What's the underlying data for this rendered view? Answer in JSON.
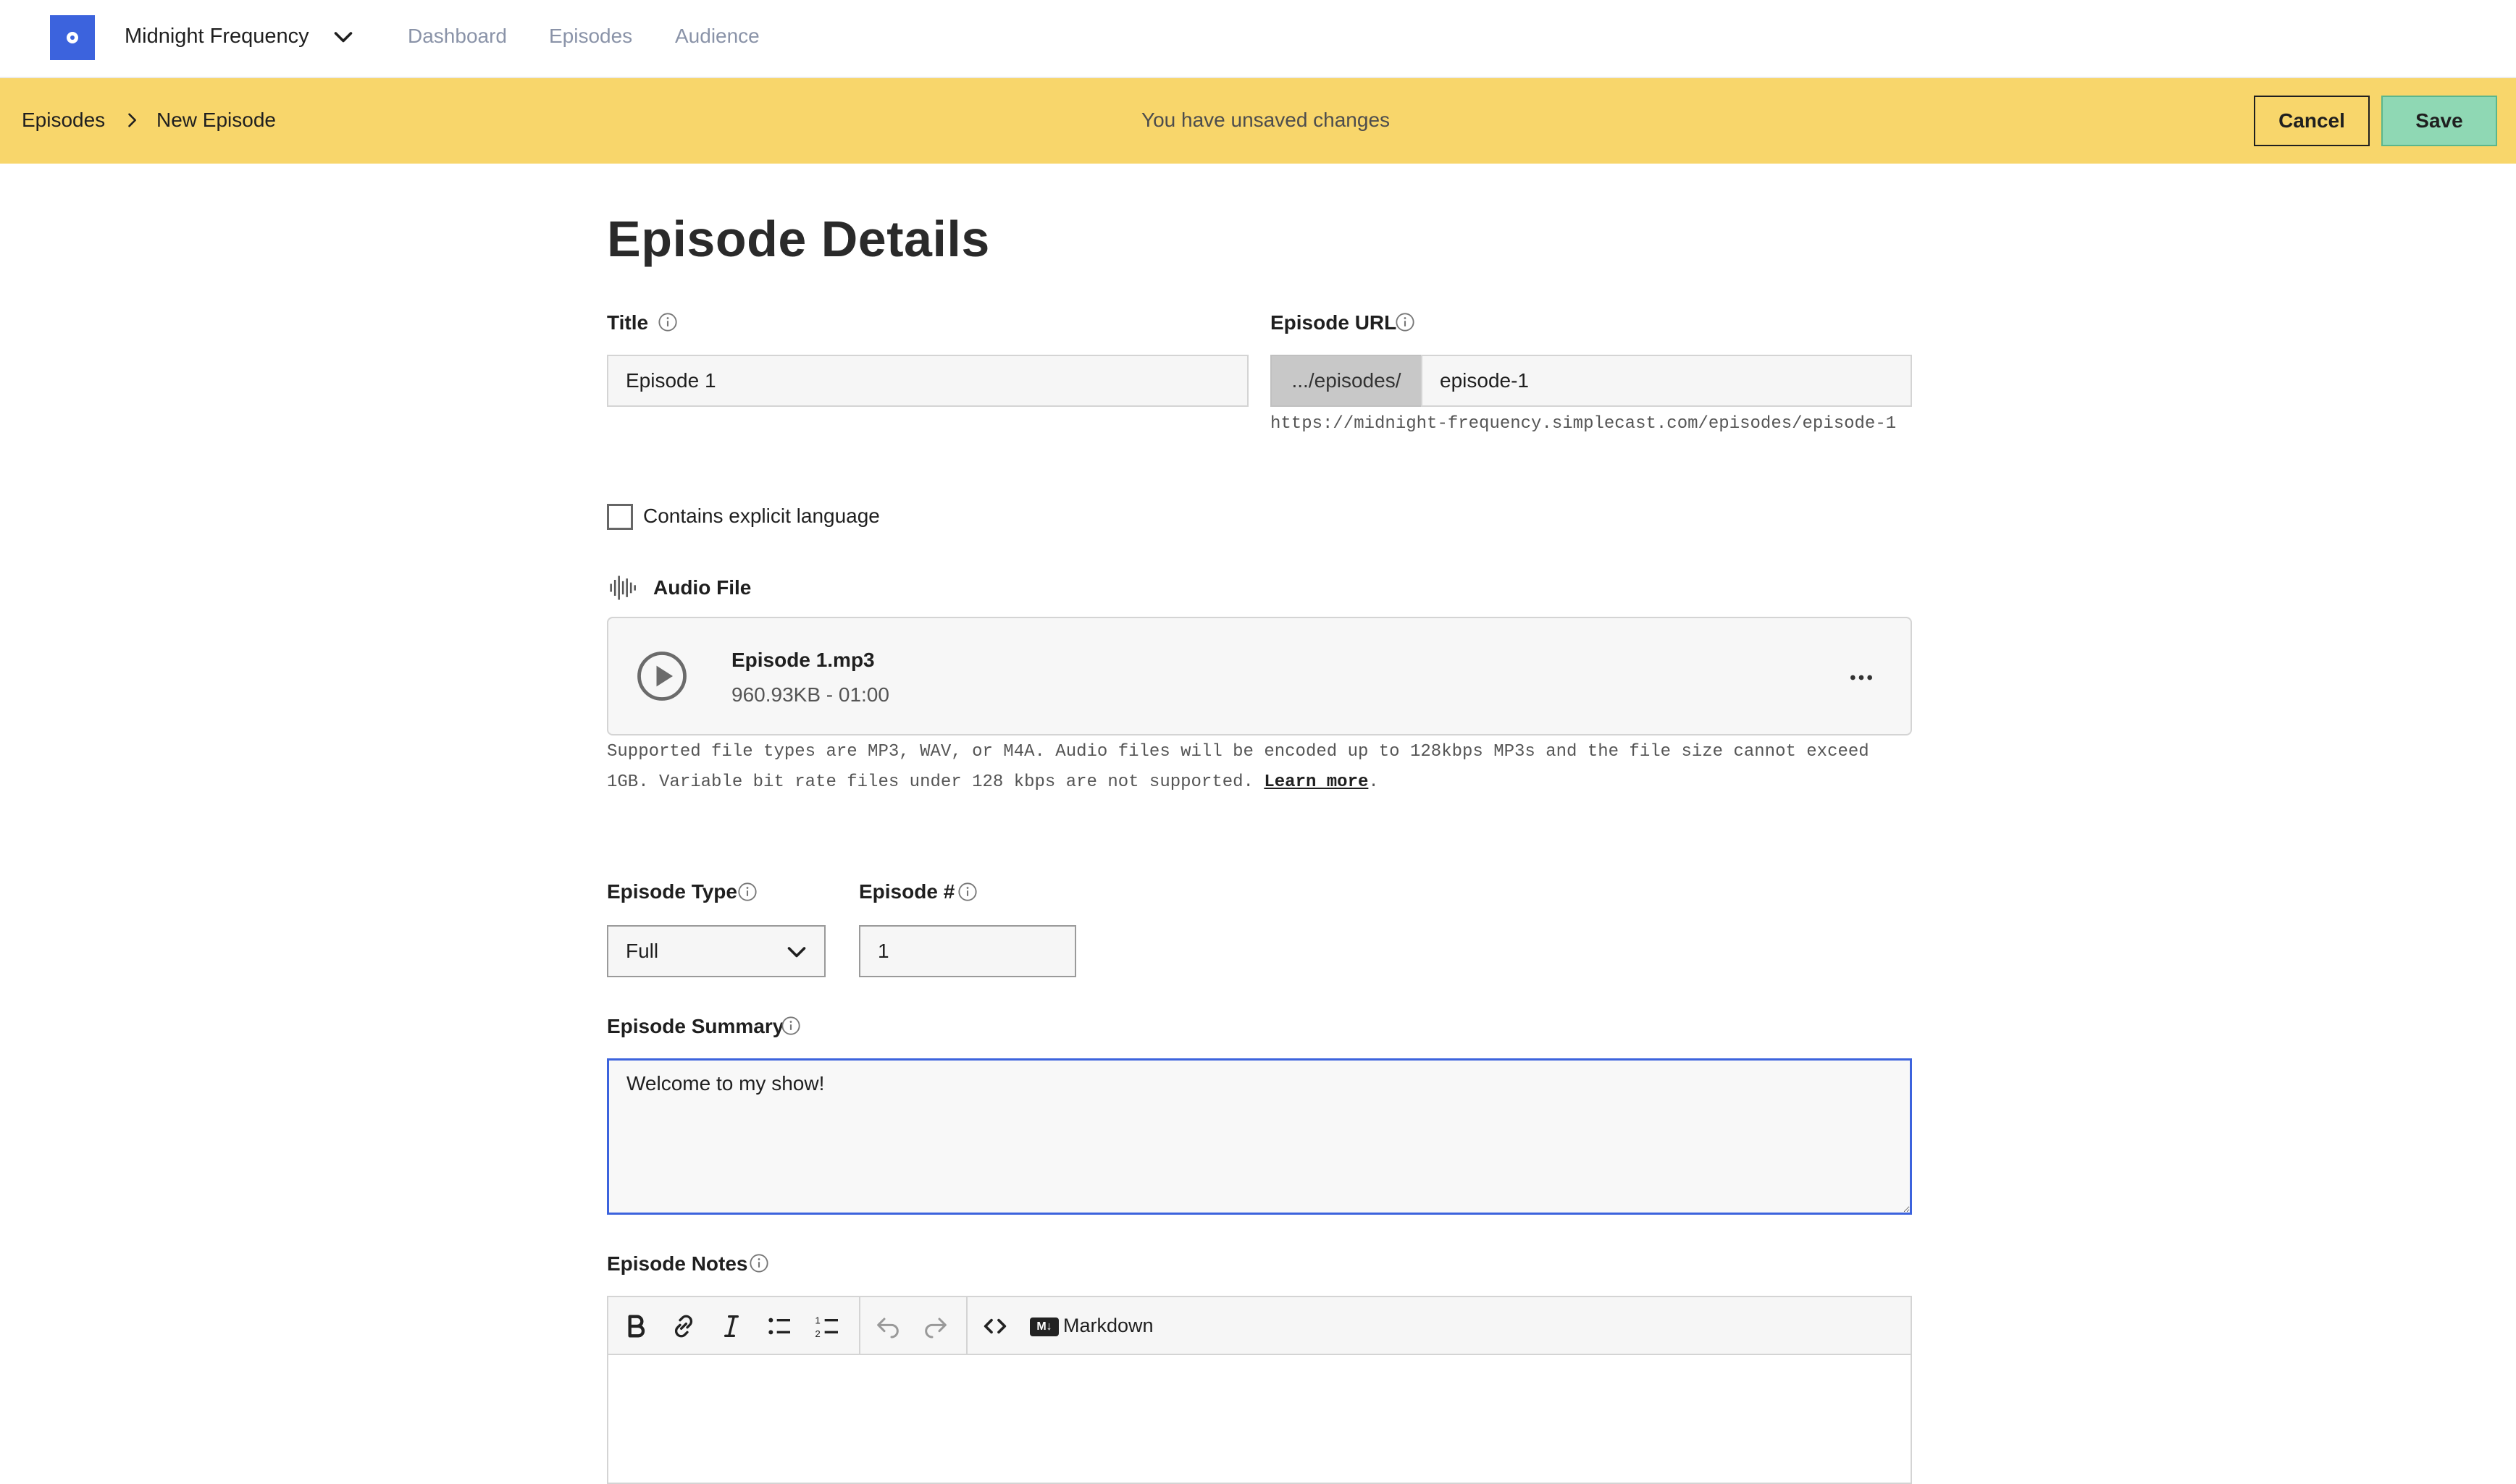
{
  "nav": {
    "podcast_name": "Midnight Frequency",
    "links": [
      "Dashboard",
      "Episodes",
      "Audience"
    ]
  },
  "banner": {
    "breadcrumb": [
      "Episodes",
      "New Episode"
    ],
    "message": "You have unsaved changes",
    "cancel_label": "Cancel",
    "save_label": "Save",
    "color": "#f8d66b"
  },
  "form": {
    "heading": "Episode Details",
    "title_label": "Title",
    "title_value": "Episode 1",
    "url_label": "Episode URL",
    "url_prefix": ".../episodes/",
    "url_slug": "episode-1",
    "url_full": "https://midnight-frequency.simplecast.com/episodes/episode-1",
    "explicit_label": "Contains explicit language",
    "explicit_checked": false,
    "audio_label": "Audio File",
    "audio_filename": "Episode 1.mp3",
    "audio_meta": "960.93KB - 01:00",
    "audio_hint": "Supported file types are MP3, WAV, or M4A. Audio files will be encoded up to 128kbps MP3s and the file size cannot exceed 1GB. Variable bit rate files under 128 kbps are not supported. ",
    "learn_more": "Learn more",
    "type_label": "Episode Type",
    "type_value": "Full",
    "number_label": "Episode #",
    "number_value": "1",
    "summary_label": "Episode Summary",
    "summary_value": "Welcome to my show!",
    "notes_label": "Episode Notes",
    "markdown_badge": "M↓",
    "markdown_label": "Markdown"
  },
  "colors": {
    "accent": "#3c63dd",
    "save_button": "#8fd8b4"
  }
}
